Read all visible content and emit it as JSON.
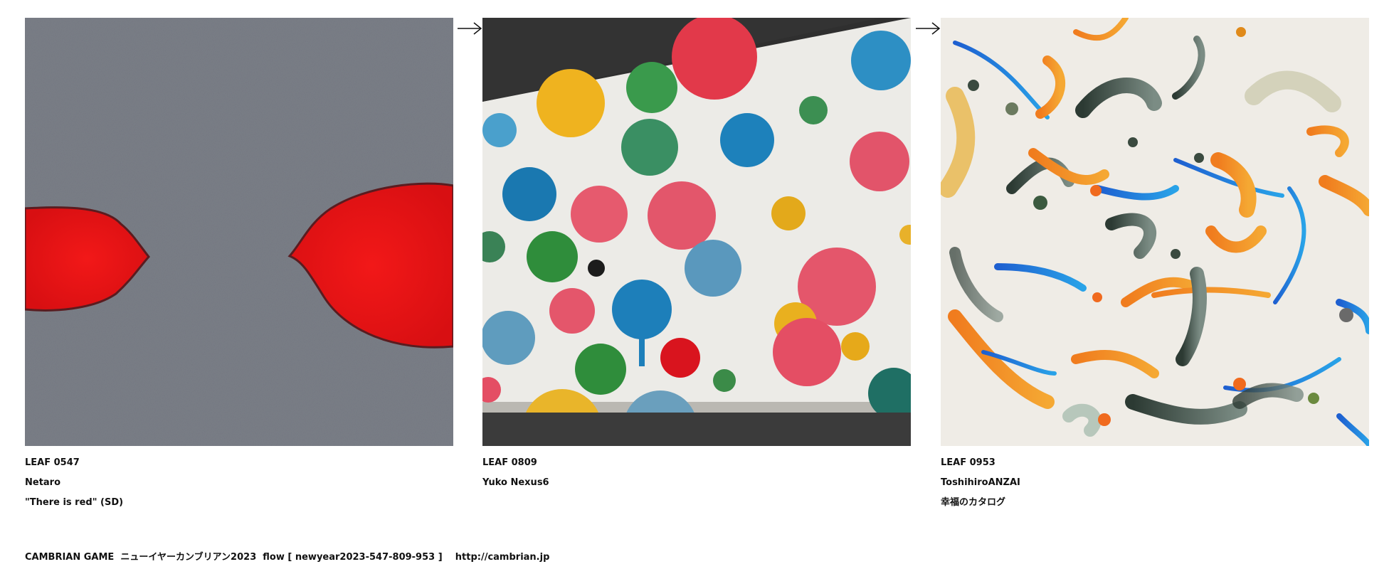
{
  "leaves": [
    {
      "id": "LEAF 0547",
      "author": "Netaro",
      "title": "\"There is red\" (SD)",
      "art": "gray-stucco-with-two-red-drops"
    },
    {
      "id": "LEAF 0809",
      "author": "Yuko Nexus6",
      "title": "",
      "art": "white-wall-with-painted-dots"
    },
    {
      "id": "LEAF 0953",
      "author": "ToshihiroANZAI",
      "title": "幸福のカタログ",
      "art": "abstract-flowing-birds-pattern"
    }
  ],
  "arrows": [
    "arrow-right-icon",
    "arrow-right-icon"
  ],
  "footer": {
    "text": "CAMBRIAN GAME  ニューイヤーカンブリアン2023  flow [ newyear2023-547-809-953 ]    http://cambrian.jp"
  }
}
